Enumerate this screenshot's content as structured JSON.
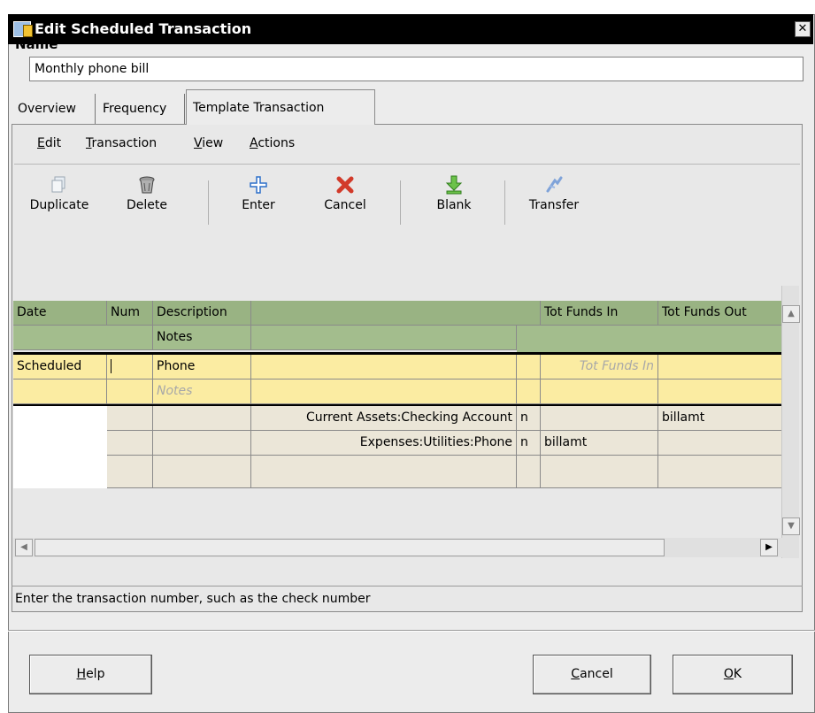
{
  "window": {
    "title": "Edit Scheduled Transaction",
    "close_glyph": "✕"
  },
  "name": {
    "label": "Name",
    "value": "Monthly phone bill"
  },
  "tabs": [
    {
      "label": "Overview"
    },
    {
      "label": "Frequency"
    },
    {
      "label": "Template Transaction"
    }
  ],
  "menu": [
    {
      "mnemonic": "E",
      "rest": "dit"
    },
    {
      "mnemonic": "T",
      "rest": "ransaction"
    },
    {
      "mnemonic": "V",
      "rest": "iew"
    },
    {
      "mnemonic": "A",
      "rest": "ctions"
    }
  ],
  "toolbar": {
    "duplicate": "Duplicate",
    "delete": "Delete",
    "enter": "Enter",
    "cancel": "Cancel",
    "blank": "Blank",
    "transfer": "Transfer"
  },
  "register": {
    "headers": {
      "date": "Date",
      "num": "Num",
      "description": "Description",
      "tot_funds_in": "Tot Funds In",
      "tot_funds_out": "Tot Funds Out",
      "notes": "Notes"
    },
    "transaction": {
      "date": "Scheduled",
      "num": "",
      "description": "Phone",
      "tot_funds_in_placeholder": "Tot Funds In",
      "notes_placeholder": "Notes"
    },
    "splits": [
      {
        "account": "Current Assets:Checking Account",
        "r": "n",
        "funds_in": "",
        "funds_out": "billamt"
      },
      {
        "account": "Expenses:Utilities:Phone",
        "r": "n",
        "funds_in": "billamt",
        "funds_out": ""
      }
    ]
  },
  "status": "Enter the transaction number, such as the check number",
  "buttons": {
    "help": {
      "mnemonic": "H",
      "rest": "elp"
    },
    "cancel": {
      "mnemonic": "C",
      "rest": "ancel"
    },
    "ok": {
      "mnemonic": "O",
      "rest": "K"
    }
  }
}
